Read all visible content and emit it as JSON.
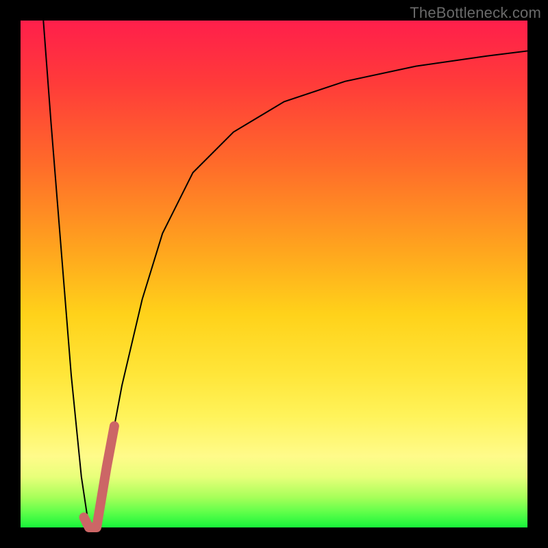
{
  "watermark": "TheBottleneck.com",
  "colors": {
    "background": "#000000",
    "curve": "#000000",
    "highlight": "#cc6666"
  },
  "chart_data": {
    "type": "line",
    "title": "",
    "xlabel": "",
    "ylabel": "",
    "xlim": [
      0,
      100
    ],
    "ylim": [
      0,
      100
    ],
    "grid": false,
    "legend": false,
    "series": [
      {
        "name": "left-branch",
        "x": [
          4.5,
          6,
          8,
          10,
          12,
          13.5
        ],
        "y": [
          100,
          80,
          55,
          30,
          10,
          0
        ]
      },
      {
        "name": "right-branch",
        "x": [
          15,
          17,
          20,
          24,
          28,
          34,
          42,
          52,
          64,
          78,
          92,
          100
        ],
        "y": [
          0,
          12,
          28,
          45,
          58,
          70,
          78,
          84,
          88,
          91,
          93,
          94
        ]
      }
    ],
    "highlight_segment": {
      "name": "bottleneck-elbow",
      "x": [
        12.5,
        13.5,
        15,
        17,
        18.5
      ],
      "y": [
        2,
        0,
        0,
        12,
        20
      ]
    }
  }
}
